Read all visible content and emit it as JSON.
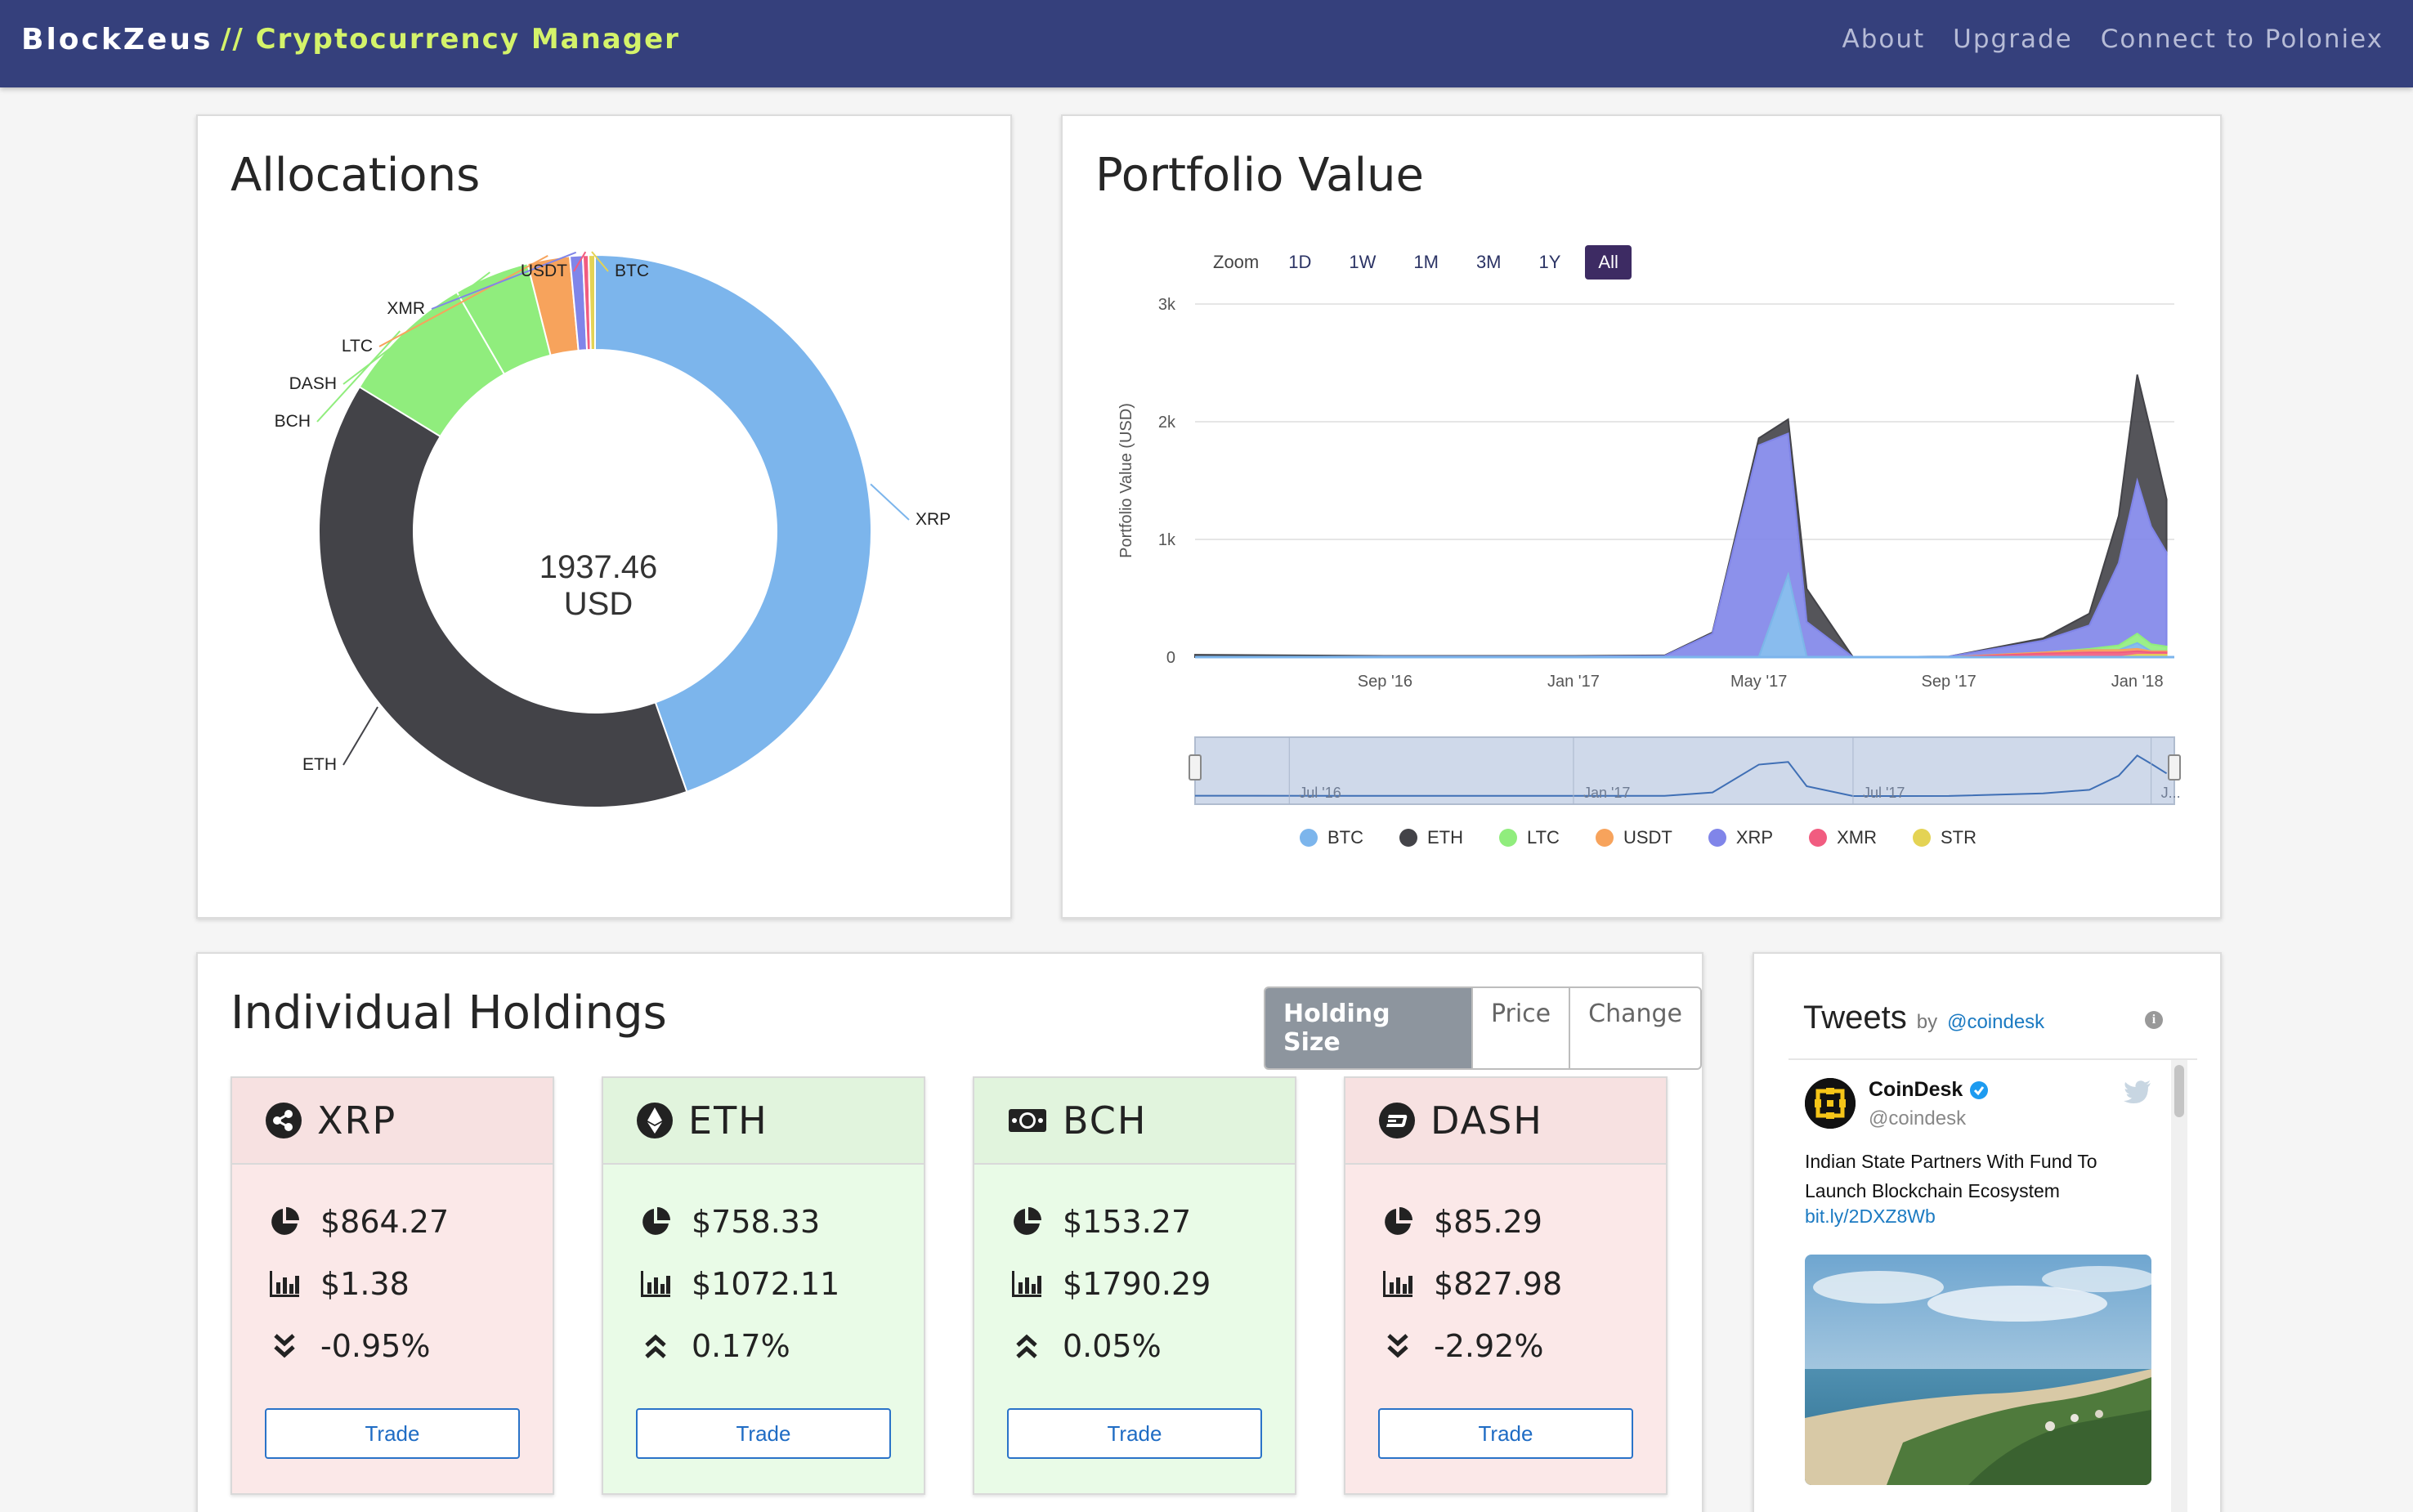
{
  "app": {
    "brand": "BlockZeus",
    "tagline": "// Cryptocurrency Manager",
    "nav": [
      "About",
      "Upgrade",
      "Connect to Poloniex"
    ]
  },
  "allocations": {
    "title": "Allocations",
    "center_label": "1937.46 USD"
  },
  "portfolio": {
    "title": "Portfolio Value",
    "zoom_label": "Zoom",
    "zoom_options": [
      "1D",
      "1W",
      "1M",
      "3M",
      "1Y",
      "All"
    ],
    "zoom_selected": "All",
    "y_axis_title": "Portfolio Value (USD)",
    "navigator_labels": [
      "Jul '16",
      "Jan '17",
      "Jul '17",
      "J..."
    ]
  },
  "chart_data": [
    {
      "type": "pie",
      "donut": true,
      "center_label": "1937.46 USD",
      "labels": [
        "XRP",
        "ETH",
        "BCH",
        "DASH",
        "LTC",
        "XMR",
        "USDT",
        "BTC"
      ],
      "values": [
        864.27,
        758.33,
        153.27,
        85.29,
        48.0,
        14.5,
        6.5,
        7.3
      ],
      "colors": [
        "#7cb5ec",
        "#434348",
        "#90ed7d",
        "#90ed7d",
        "#f7a35c",
        "#8085e9",
        "#f15c80",
        "#e4d354"
      ]
    },
    {
      "type": "area",
      "title": "Portfolio Value",
      "ylabel": "Portfolio Value (USD)",
      "ylim": [
        0,
        3000
      ],
      "y_ticks": [
        "0",
        "1k",
        "2k",
        "3k"
      ],
      "x_ticks": [
        "Sep '16",
        "Jan '17",
        "May '17",
        "Sep '17",
        "Jan '18"
      ],
      "x": [
        "2016-05",
        "2016-09",
        "2017-01",
        "2017-03",
        "2017-04",
        "2017-05",
        "2017-05-20",
        "2017-06",
        "2017-07",
        "2017-09",
        "2017-11",
        "2017-12",
        "2017-12-20",
        "2018-01",
        "2018-01-10",
        "2018-01-20"
      ],
      "series": [
        {
          "name": "BTC",
          "color": "#7cb5ec",
          "values": [
            0,
            0,
            0,
            0,
            0,
            0,
            700,
            0,
            0,
            0,
            0,
            0,
            0,
            50,
            0,
            0
          ]
        },
        {
          "name": "ETH",
          "color": "#434348",
          "values": [
            20,
            5,
            5,
            5,
            10,
            60,
            120,
            280,
            0,
            0,
            20,
            100,
            400,
            900,
            800,
            450
          ]
        },
        {
          "name": "LTC",
          "color": "#90ed7d",
          "values": [
            0,
            0,
            0,
            0,
            0,
            0,
            0,
            0,
            0,
            0,
            0,
            10,
            40,
            80,
            60,
            40
          ]
        },
        {
          "name": "USDT",
          "color": "#f7a35c",
          "values": [
            0,
            0,
            0,
            0,
            0,
            0,
            0,
            0,
            0,
            0,
            10,
            20,
            20,
            20,
            10,
            10
          ]
        },
        {
          "name": "XRP",
          "color": "#8085e9",
          "values": [
            0,
            5,
            5,
            10,
            200,
            1800,
            1200,
            300,
            0,
            5,
            100,
            200,
            700,
            1300,
            1000,
            800
          ]
        },
        {
          "name": "XMR",
          "color": "#f15c80",
          "values": [
            0,
            0,
            0,
            0,
            0,
            0,
            0,
            0,
            0,
            0,
            30,
            40,
            40,
            30,
            20,
            20
          ]
        },
        {
          "name": "STR",
          "color": "#e4d354",
          "values": [
            0,
            0,
            0,
            0,
            0,
            0,
            0,
            0,
            0,
            0,
            0,
            0,
            0,
            20,
            20,
            20
          ]
        }
      ],
      "legend": [
        "BTC",
        "ETH",
        "LTC",
        "USDT",
        "XRP",
        "XMR",
        "STR"
      ],
      "legend_placement": "bottom",
      "grid": true
    }
  ],
  "holdings": {
    "title": "Individual Holdings",
    "toggle": [
      "Holding Size",
      "Price",
      "Change"
    ],
    "toggle_selected": "Holding Size",
    "cards": [
      {
        "coin": "XRP",
        "size": "$864.27",
        "price": "$1.38",
        "change": "-0.95%",
        "trend": "down",
        "trade": "Trade"
      },
      {
        "coin": "ETH",
        "size": "$758.33",
        "price": "$1072.11",
        "change": "0.17%",
        "trend": "up",
        "trade": "Trade"
      },
      {
        "coin": "BCH",
        "size": "$153.27",
        "price": "$1790.29",
        "change": "0.05%",
        "trend": "up",
        "trade": "Trade"
      },
      {
        "coin": "DASH",
        "size": "$85.29",
        "price": "$827.98",
        "change": "-2.92%",
        "trend": "down",
        "trade": "Trade"
      }
    ]
  },
  "tweets": {
    "title": "Tweets",
    "by": "by",
    "by_handle": "@coindesk",
    "tweet": {
      "name": "CoinDesk",
      "handle": "@coindesk",
      "text": "Indian State Partners With Fund To Launch Blockchain Ecosystem",
      "link": "bit.ly/2DXZ8Wb"
    }
  },
  "colors": {
    "navbar": "#35407c",
    "tagline": "#d4f36a",
    "up_card": "#e9fbe7",
    "down_card": "#fbe8e8",
    "link": "#1b7ac2"
  }
}
